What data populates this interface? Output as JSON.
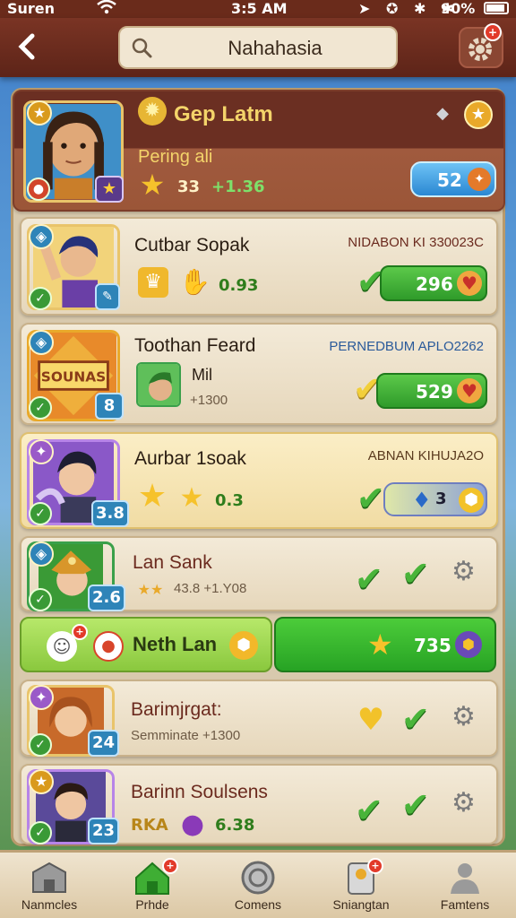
{
  "status_bar": {
    "carrier": "Suren",
    "time": "3:5 AM",
    "battery": "90%"
  },
  "header": {
    "search_value": "Nahahasia"
  },
  "top_card": {
    "name": "Gep Latm",
    "subtitle": "Pering ali",
    "stars": "33",
    "delta": "+1.36",
    "score": "52",
    "level_icon": "star-icon"
  },
  "rows": [
    {
      "name": "Cutbar Sopak",
      "tag": "NIDABON KI 330023C",
      "stat": "0.93",
      "score": "296"
    },
    {
      "name": "Toothan Feard",
      "tag": "PERNEDBUM APLO2262",
      "logo_text": "SOUNAS",
      "level": "8",
      "mini_name": "Mil",
      "mini_sub": "+1300",
      "score": "529"
    },
    {
      "name": "Aurbar 1soak",
      "tag": "ABNAN KIHUJA2O",
      "level": "3.8",
      "stat": "0.3",
      "score": "3"
    },
    {
      "name": "Lan Sank",
      "sub": "43.8 +1.Y08",
      "level": "2.6"
    },
    {
      "name": "Barimjrgat:",
      "sub": "Semminate +1300",
      "level": "24"
    },
    {
      "name": "Barinn Soulsens",
      "sub_prefix": "RKA",
      "stat": "6.38",
      "level": "23"
    }
  ],
  "banner": {
    "label": "Neth Lan",
    "score": "735"
  },
  "bottom_nav": [
    {
      "label": "Nanmcles",
      "icon": "building-icon"
    },
    {
      "label": "Prhde",
      "icon": "home-icon"
    },
    {
      "label": "Comens",
      "icon": "coin-icon"
    },
    {
      "label": "Sniangtan",
      "icon": "card-icon"
    },
    {
      "label": "Famtens",
      "icon": "person-icon"
    }
  ],
  "colors": {
    "header": "#6a2b1b",
    "accent_green": "#3fae34",
    "gold": "#e9b43a"
  }
}
